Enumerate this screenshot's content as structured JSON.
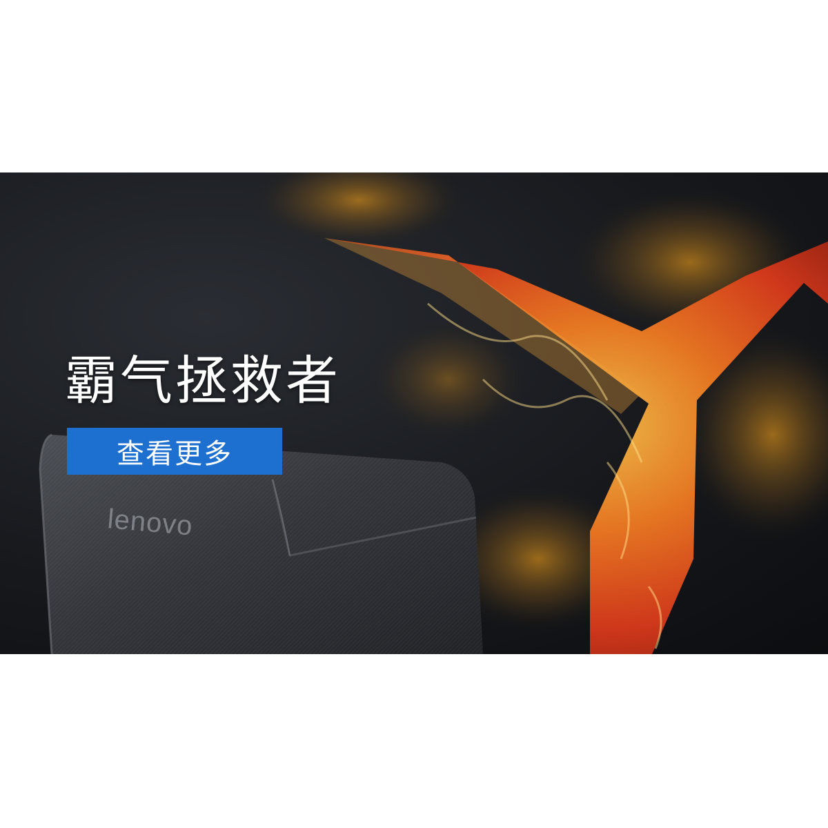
{
  "banner": {
    "headline": "霸气拯救者",
    "cta_label": "查看更多",
    "laptop_brand": "lenovo",
    "colors": {
      "cta_background": "#1d6fd0",
      "fire_core": "#e4431c",
      "fire_glow": "#f3a521",
      "background": "#17191d"
    },
    "icons": [
      "legion-y-logo",
      "laptop-lid"
    ]
  }
}
